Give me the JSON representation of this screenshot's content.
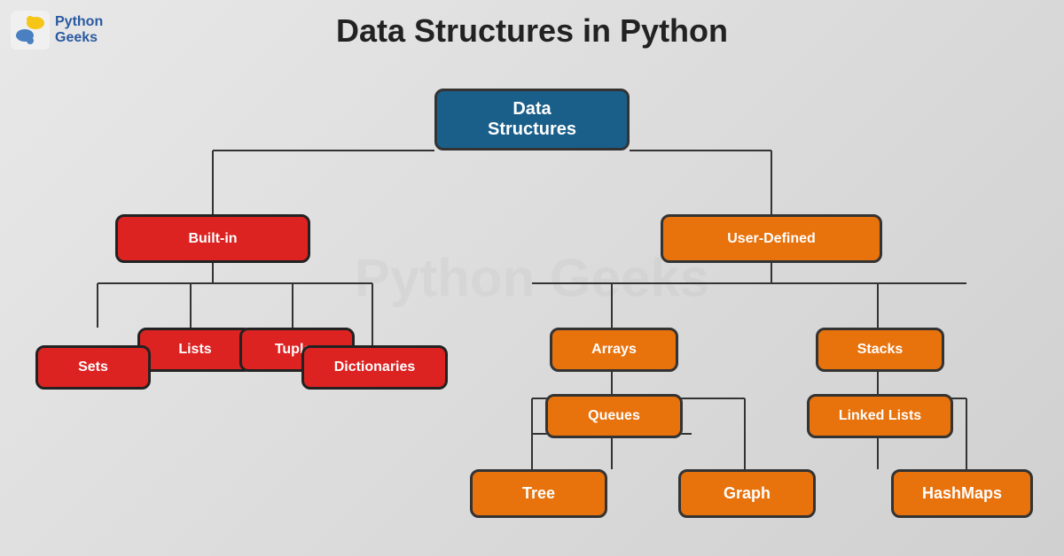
{
  "logo": {
    "python": "Python",
    "geeks": "Geeks"
  },
  "title": "Data Structures in Python",
  "nodes": {
    "root": {
      "label": "Data\nStructures",
      "type": "blue"
    },
    "builtin": {
      "label": "Built-in",
      "type": "red"
    },
    "userdefined": {
      "label": "User-Defined",
      "type": "orange"
    },
    "lists": {
      "label": "Lists",
      "type": "red"
    },
    "tuples": {
      "label": "Tuples",
      "type": "red"
    },
    "sets": {
      "label": "Sets",
      "type": "red"
    },
    "dictionaries": {
      "label": "Dictionaries",
      "type": "red"
    },
    "arrays": {
      "label": "Arrays",
      "type": "orange"
    },
    "stacks": {
      "label": "Stacks",
      "type": "orange"
    },
    "queues": {
      "label": "Queues",
      "type": "orange"
    },
    "linkedlists": {
      "label": "Linked Lists",
      "type": "orange"
    },
    "tree": {
      "label": "Tree",
      "type": "orange"
    },
    "graph": {
      "label": "Graph",
      "type": "orange"
    },
    "hashmaps": {
      "label": "HashMaps",
      "type": "orange"
    }
  },
  "colors": {
    "blue": "#1a5f8a",
    "red": "#dd2222",
    "orange": "#e8720c",
    "border": "#333"
  }
}
